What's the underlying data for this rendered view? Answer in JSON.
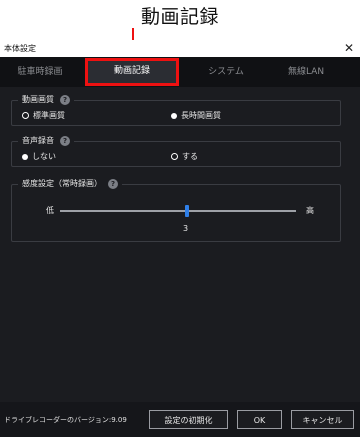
{
  "callout": {
    "label": "動画記録"
  },
  "window": {
    "title": "本体設定",
    "close_glyph": "✕"
  },
  "tabs": [
    {
      "label": "駐車時録画",
      "active": false
    },
    {
      "label": "動画記録",
      "active": true
    },
    {
      "label": "システム",
      "active": false
    },
    {
      "label": "無線LAN",
      "active": false
    }
  ],
  "groups": {
    "video_quality": {
      "title": "動画画質",
      "help": "?",
      "options": [
        {
          "label": "標準画質",
          "selected": true
        },
        {
          "label": "長時間画質",
          "selected": false
        }
      ]
    },
    "audio_recording": {
      "title": "音声録音",
      "help": "?",
      "options": [
        {
          "label": "しない",
          "selected": false
        },
        {
          "label": "する",
          "selected": true
        }
      ]
    },
    "sensitivity": {
      "title": "感度設定（常時録画）",
      "help": "?",
      "min_label": "低",
      "max_label": "高",
      "value": "3"
    }
  },
  "footer": {
    "version_label": "ドライブレコーダーのバージョン:9.09",
    "reset_button": "設定の初期化",
    "ok_button": "OK",
    "cancel_button": "キャンセル"
  },
  "colors": {
    "highlight": "#ee1111",
    "slider_thumb": "#2f7fe8",
    "panel_bg": "#1b1c20"
  }
}
